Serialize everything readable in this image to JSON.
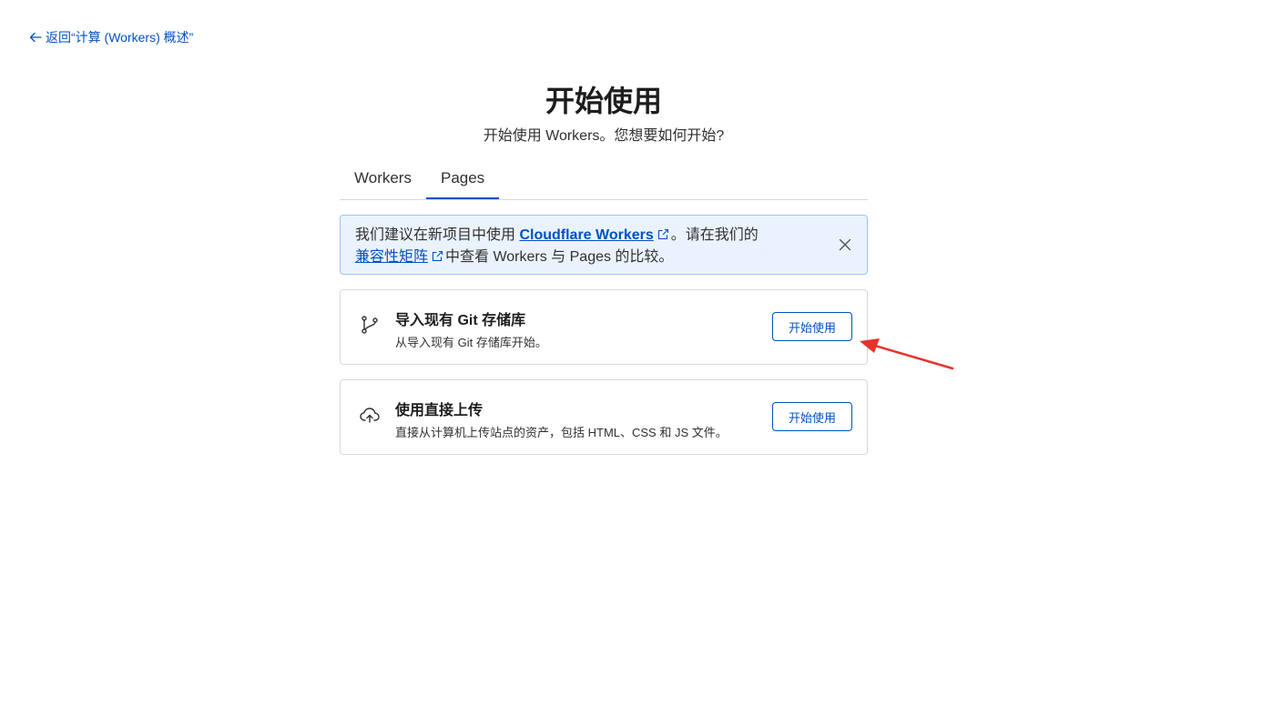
{
  "back_link": {
    "label": "返回“计算 (Workers) 概述”"
  },
  "header": {
    "title": "开始使用",
    "subtitle": "开始使用 Workers。您想要如何开始?"
  },
  "tabs": [
    {
      "label": "Workers",
      "active": false
    },
    {
      "label": "Pages",
      "active": true
    }
  ],
  "notice": {
    "text_1": "我们建议在新项目中使用 ",
    "link_1": "Cloudflare Workers",
    "text_2": "。请在我们的",
    "link_2": "兼容性矩阵",
    "text_3": "中查看 Workers 与 Pages 的比较。"
  },
  "cards": [
    {
      "icon": "git-branch-icon",
      "title": "导入现有 Git 存储库",
      "description": "从导入现有 Git 存储库开始。",
      "button_label": "开始使用"
    },
    {
      "icon": "cloud-upload-icon",
      "title": "使用直接上传",
      "description": "直接从计算机上传站点的资产，包括 HTML、CSS 和 JS 文件。",
      "button_label": "开始使用"
    }
  ],
  "colors": {
    "accent": "#0051c3",
    "notice_bg": "#eaf3fd",
    "notice_border": "#9bc4f4",
    "annotation_arrow": "#e8322b"
  }
}
